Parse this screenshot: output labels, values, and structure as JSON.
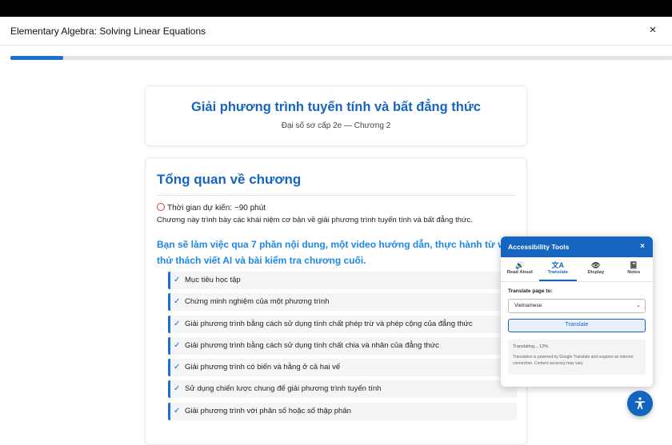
{
  "window": {
    "title": "Elementary Algebra: Solving Linear Equations",
    "close_icon": "×"
  },
  "progress": {
    "value": 0.08
  },
  "hero": {
    "title": "Giải phương trình tuyến tính và bất đẳng thức",
    "subtitle": "Đại số sơ cấp 2e — Chương 2"
  },
  "overview": {
    "heading": "Tổng quan về chương",
    "time": "Thời gian dự kiến: ~90 phút",
    "intro": "Chương này trình bày các khái niệm cơ bản về giải phương trình tuyến tính và bất đẳng thức.",
    "lead": "Bạn sẽ làm việc qua 7 phần nội dung, một video hướng dẫn, thực hành từ vựng, thử thách viết AI và bài kiểm tra chương cuối.",
    "items": [
      "Mục tiêu học tập",
      "Chứng minh nghiệm của một phương trình",
      "Giải phương trình bằng cách sử dụng tính chất phép trừ và phép cộng của đẳng thức",
      "Giải phương trình bằng cách sử dụng tính chất chia và nhân của đẳng thức",
      "Giải phương trình có biến và hằng ở cả hai vế",
      "Sử dụng chiến lược chung để giải phương trình tuyến tính",
      "Giải phương trình với phân số hoặc số thập phân"
    ],
    "check_glyph": "✓"
  },
  "accessibility": {
    "title": "Accessibility Tools",
    "close": "×",
    "tabs": [
      {
        "label": "Read Aloud",
        "icon": "speaker-icon",
        "glyph": "🔊"
      },
      {
        "label": "Translate",
        "icon": "translate-icon",
        "glyph": "文A"
      },
      {
        "label": "Display",
        "icon": "eye-icon",
        "glyph": "👁"
      },
      {
        "label": "Notes",
        "icon": "notebook-icon",
        "glyph": "📓"
      }
    ],
    "active_tab": "Translate",
    "translate_label": "Translate page to:",
    "language": "Vietnamese",
    "button": "Translate",
    "status": "Translating... 12%",
    "note": "Translation is powered by Google Translate and requires an internet connection. Content accuracy may vary."
  },
  "colors": {
    "accent": "#1565c0",
    "link": "#1e88e5"
  }
}
